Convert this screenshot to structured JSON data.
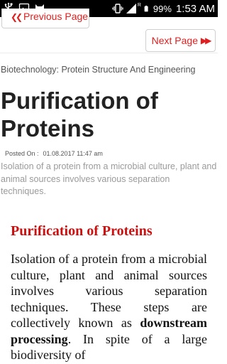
{
  "status_bar": {
    "battery": "99%",
    "time": "1:53",
    "time_suffix": "AM",
    "network_label": "R",
    "icons": [
      "usb-icon",
      "image-icon",
      "cat-icon",
      "vibrate-icon",
      "signal-icon",
      "battery-icon"
    ]
  },
  "nav": {
    "prev_arrows": "❮❮",
    "prev_label": "Previous Page",
    "next_label": "Next Page",
    "next_arrows": "▶▶"
  },
  "breadcrumb": "Biotechnology: Protein Structure And Engineering",
  "title": "Purification of Proteins",
  "posted": {
    "label": "Posted On :",
    "date": "01.08.2017 11:47 am"
  },
  "summary": "Isolation of a protein from a microbial culture, plant and animal sources involves various separation techniques.",
  "article": {
    "heading": "Purification of Proteins",
    "body_before_bold": "Isolation of a protein from a microbial culture, plant and animal sources involves various separation techniques. These steps are collectively known as ",
    "body_bold": "downstream processing",
    "body_after_bold": ". In spite of a large biodiversity of"
  },
  "colors": {
    "accent": "#e02020",
    "heading_red": "#cc1010",
    "summary_gray": "#9a9a9a"
  }
}
